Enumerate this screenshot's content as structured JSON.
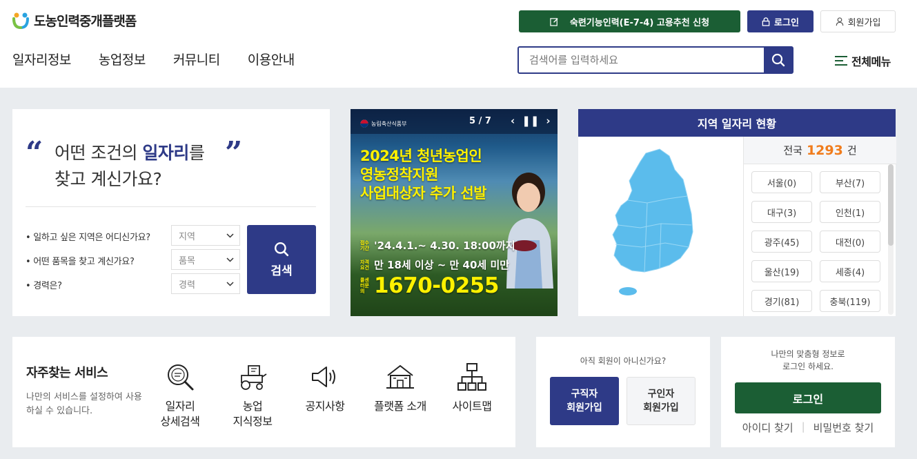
{
  "header": {
    "logo_text": "도농인력중개플랫폼",
    "apply_label": "숙련기능인력(E-7-4) 고용추천 신청",
    "login_label": "로그인",
    "signup_label": "회원가입",
    "nav": [
      "일자리정보",
      "농업정보",
      "커뮤니티",
      "이용안내"
    ],
    "search_placeholder": "검색어를 입력하세요",
    "all_menu_label": "전체메뉴"
  },
  "condition": {
    "line1_a": "어떤 조건의 ",
    "line1_b": "일자리",
    "line1_c": "를",
    "line2": "찾고 계신가요?",
    "q_region": "• 일하고 싶은 지역은 어디신가요?",
    "q_item": "• 어떤 품목을 찾고 계신가요?",
    "q_career": "• 경력은?",
    "sel_region": "지역",
    "sel_item": "품목",
    "sel_career": "경력",
    "search_label": "검색"
  },
  "banner": {
    "ministry": "농림축산식품부",
    "counter": "5 / 7",
    "title1": "2024년 청년농업인",
    "title2": "영농정착지원",
    "title3": "사업대상자 추가 선발",
    "tag1": "접수기간",
    "period": "'24.4.1.~ 4.30. 18:00까지",
    "tag2": "자격요건",
    "requirement": "만 18세 이상 ~ 만 40세 미만",
    "tag3": "콜센터문의",
    "phone": "1670-0255"
  },
  "region": {
    "title": "지역 일자리 현황",
    "total_prefix": "전국",
    "total_count": "1293",
    "total_suffix": "건",
    "items": [
      "서울(0)",
      "부산(7)",
      "대구(3)",
      "인천(1)",
      "광주(45)",
      "대전(0)",
      "울산(19)",
      "세종(4)",
      "경기(81)",
      "충북(119)"
    ]
  },
  "services": {
    "title": "자주찾는 서비스",
    "desc": "나만의 서비스를 설정하여 사용하실 수 있습니다.",
    "items": [
      {
        "line1": "일자리",
        "line2": "상세검색",
        "icon": "magnifier-document-icon"
      },
      {
        "line1": "농업",
        "line2": "지식정보",
        "icon": "tractor-icon"
      },
      {
        "line1": "공지사항",
        "line2": "",
        "icon": "megaphone-icon"
      },
      {
        "line1": "플랫폼 소개",
        "line2": "",
        "icon": "farmhouse-icon"
      },
      {
        "line1": "사이트맵",
        "line2": "",
        "icon": "sitemap-icon"
      }
    ]
  },
  "join": {
    "question": "아직 회원이 아니신가요?",
    "seeker_1": "구직자",
    "seeker_2": "회원가입",
    "employer_1": "구인자",
    "employer_2": "회원가입"
  },
  "login": {
    "msg1": "나만의 맞춤형 정보로",
    "msg2": "로그인 하세요.",
    "button": "로그인",
    "find_id": "아이디 찾기",
    "find_pw": "비밀번호 찾기"
  },
  "colors": {
    "navy": "#2e3a87",
    "green": "#1b5e34",
    "orange": "#f07c1c",
    "map": "#5bbcec"
  }
}
